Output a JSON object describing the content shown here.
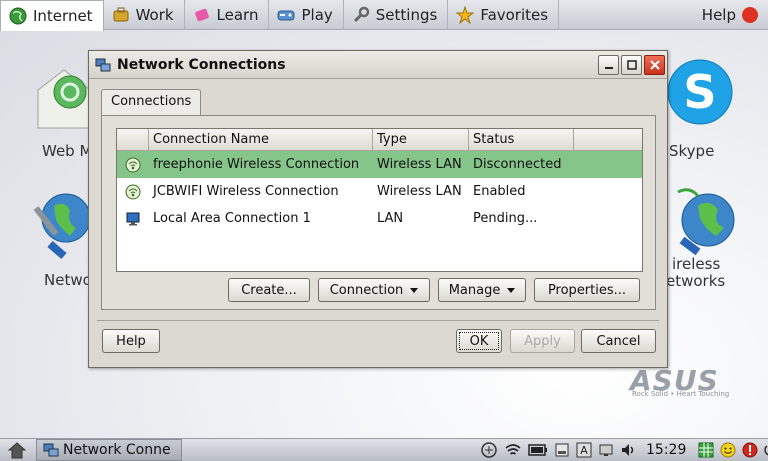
{
  "topbar": {
    "tabs": [
      {
        "label": "Internet",
        "icon": "globe-icon"
      },
      {
        "label": "Work",
        "icon": "briefcase-icon"
      },
      {
        "label": "Learn",
        "icon": "eraser-icon"
      },
      {
        "label": "Play",
        "icon": "gamepad-icon"
      },
      {
        "label": "Settings",
        "icon": "wrench-icon"
      },
      {
        "label": "Favorites",
        "icon": "star-icon"
      }
    ],
    "help_label": "Help"
  },
  "desktop": {
    "icons": [
      {
        "label": "Web M"
      },
      {
        "label": "Netwo"
      },
      {
        "label": "Skype"
      },
      {
        "label": "ireless"
      },
      {
        "label": "etworks"
      }
    ],
    "brand": "ASUS",
    "brand_tagline": "Rock Solid • Heart Touching"
  },
  "dialog": {
    "title": "Network Connections",
    "tab_label": "Connections",
    "columns": [
      "Connection Name",
      "Type",
      "Status"
    ],
    "rows": [
      {
        "name": "freephonie Wireless Connection",
        "type": "Wireless LAN",
        "status": "Disconnected",
        "icon": "wireless-icon",
        "selected": true
      },
      {
        "name": "JCBWIFI Wireless Connection",
        "type": "Wireless LAN",
        "status": "Enabled",
        "icon": "wireless-icon",
        "selected": false
      },
      {
        "name": "Local Area Connection 1",
        "type": "LAN",
        "status": "Pending...",
        "icon": "lan-monitor-icon",
        "selected": false
      }
    ],
    "buttons": {
      "create": "Create...",
      "connection": "Connection",
      "manage": "Manage",
      "properties": "Properties...",
      "help": "Help",
      "ok": "OK",
      "apply": "Apply",
      "cancel": "Cancel"
    }
  },
  "taskbar": {
    "app_label": "Network Conne",
    "clock": "15:29"
  },
  "colors": {
    "selected_row": "#86c58a",
    "dialog_bg": "#dcd9d2",
    "close_button": "#c8321e"
  }
}
